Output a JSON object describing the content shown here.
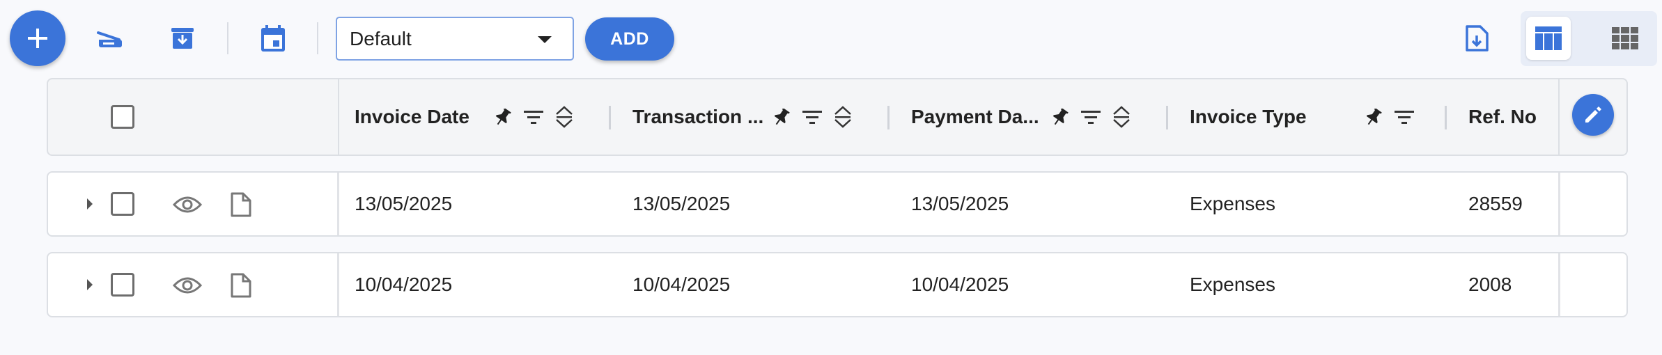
{
  "toolbar": {
    "add_fab_icon": "plus-icon",
    "scan_icon": "scanner-icon",
    "archive_icon": "archive-download-icon",
    "calendar_icon": "calendar-icon",
    "view_select": {
      "value": "Default"
    },
    "add_label": "ADD",
    "export_icon": "file-download-icon",
    "view_modes": [
      "table-view-icon",
      "grid-view-icon"
    ],
    "accent": "#3b74d9"
  },
  "table": {
    "columns": [
      {
        "title": "Invoice Date",
        "icons": [
          "pin",
          "filter",
          "sort"
        ]
      },
      {
        "title": "Transaction ...",
        "icons": [
          "pin",
          "filter",
          "sort"
        ]
      },
      {
        "title": "Payment Da...",
        "icons": [
          "pin",
          "filter",
          "sort"
        ]
      },
      {
        "title": "Invoice Type",
        "icons": [
          "pin",
          "filter"
        ]
      },
      {
        "title": "Ref. No",
        "icons": []
      }
    ],
    "rows": [
      {
        "invoice_date": "13/05/2025",
        "transaction_date": "13/05/2025",
        "payment_date": "13/05/2025",
        "invoice_type": "Expenses",
        "ref_no": "28559"
      },
      {
        "invoice_date": "10/04/2025",
        "transaction_date": "10/04/2025",
        "payment_date": "10/04/2025",
        "invoice_type": "Expenses",
        "ref_no": "2008"
      }
    ]
  }
}
